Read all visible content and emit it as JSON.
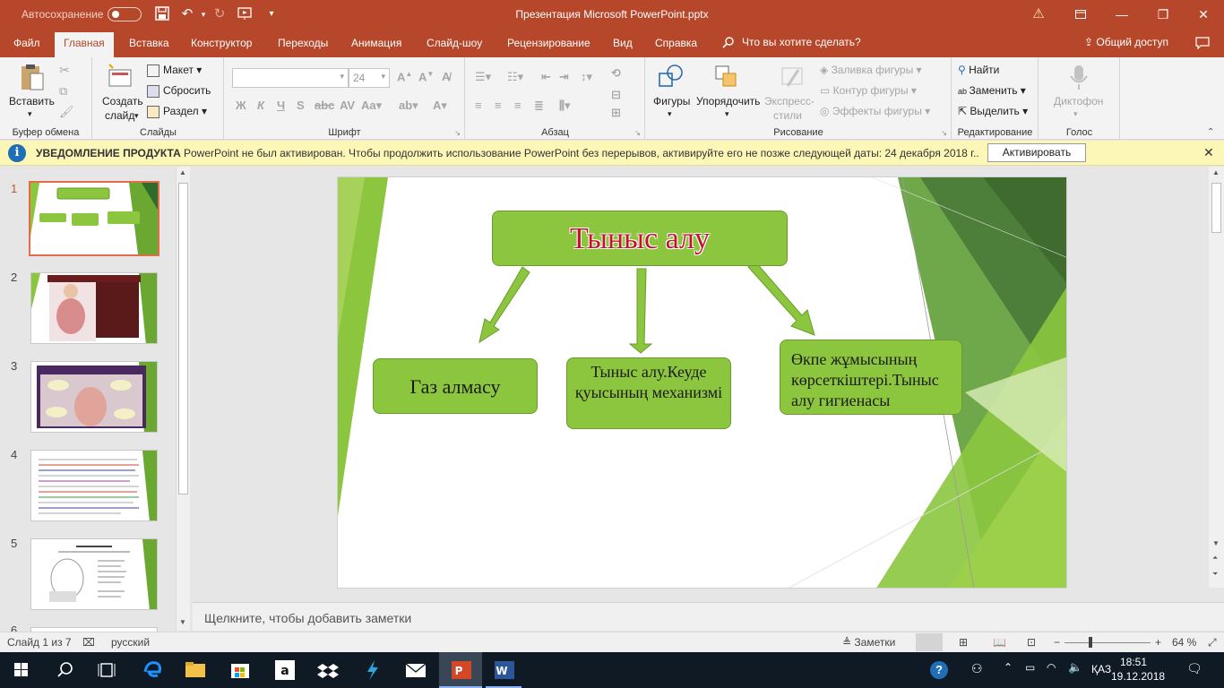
{
  "titlebar": {
    "autosave_label": "Автосохранение",
    "title": "Презентация Microsoft PowerPoint.pptx",
    "warning_icon": "warning-icon",
    "colors": {
      "accent": "#b7472a"
    }
  },
  "tabs": {
    "file": "Файл",
    "home": "Главная",
    "insert": "Вставка",
    "design": "Конструктор",
    "transitions": "Переходы",
    "animation": "Анимация",
    "slideshow": "Слайд-шоу",
    "review": "Рецензирование",
    "view": "Вид",
    "help": "Справка",
    "tell_me": "Что вы хотите сделать?",
    "share": "Общий доступ"
  },
  "ribbon": {
    "clipboard": {
      "paste": "Вставить",
      "label": "Буфер обмена"
    },
    "slides": {
      "new_slide_1": "Создать",
      "new_slide_2": "слайд",
      "layout": "Макет",
      "reset": "Сбросить",
      "section": "Раздел",
      "label": "Слайды"
    },
    "font": {
      "size": "24",
      "bold": "Ж",
      "italic": "К",
      "underline": "Ч",
      "strike": "S",
      "label": "Шрифт"
    },
    "paragraph": {
      "label": "Абзац"
    },
    "drawing": {
      "shapes": "Фигуры",
      "arrange": "Упорядочить",
      "quick_styles_1": "Экспресс-",
      "quick_styles_2": "стили",
      "fill": "Заливка фигуры",
      "outline": "Контур фигуры",
      "effects": "Эффекты фигуры",
      "label": "Рисование"
    },
    "editing": {
      "find": "Найти",
      "replace": "Заменить",
      "select": "Выделить",
      "label": "Редактирование"
    },
    "voice": {
      "dictate": "Диктофон",
      "label": "Голос"
    }
  },
  "notification": {
    "title": "УВЕДОМЛЕНИЕ ПРОДУКТА",
    "message": "PowerPoint не был активирован. Чтобы продолжить использование PowerPoint без перерывов, активируйте его не позже следующей даты: 24 декабря 2018 г..",
    "button": "Активировать"
  },
  "thumbnails": {
    "items": [
      {
        "num": "1"
      },
      {
        "num": "2"
      },
      {
        "num": "3"
      },
      {
        "num": "4"
      },
      {
        "num": "5"
      },
      {
        "num": "6"
      }
    ]
  },
  "slide": {
    "title": "Тыныс алу",
    "box1": "Газ алмасу",
    "box2": "Тыныс алу.Кеуде қуысының механизмі",
    "box3": "Өкпе жұмысының көрсеткіштері.Тыныс алу гигиенасы"
  },
  "notes": {
    "placeholder": "Щелкните, чтобы добавить заметки"
  },
  "status": {
    "slide_counter": "Слайд 1 из 7",
    "language": "русский",
    "notes_btn": "Заметки",
    "zoom": "64 %"
  },
  "taskbar": {
    "lang": "ҚАЗ",
    "time": "18:51",
    "date": "19.12.2018"
  }
}
